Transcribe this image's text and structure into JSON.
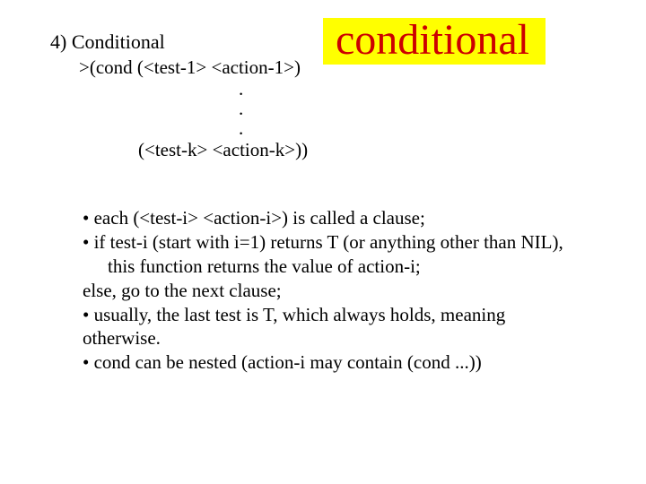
{
  "titleBox": "conditional",
  "heading": "4) Conditional",
  "code": {
    "line1": ">(cond (<test-1> <action-1>)",
    "dot": ".",
    "line2": "(<test-k> <action-k>))"
  },
  "bullets": {
    "b1": "• each (<test-i> <action-i>) is called a clause;",
    "b2": "• if test-i (start with i=1) returns T (or anything other than NIL),",
    "b2b": "this function returns the value of action-i;",
    "b2c": "else, go to the next clause;",
    "b3": "• usually, the last test is T, which always holds, meaning",
    "b3b": "otherwise.",
    "b4": "• cond can be nested (action-i may contain (cond ...))"
  }
}
